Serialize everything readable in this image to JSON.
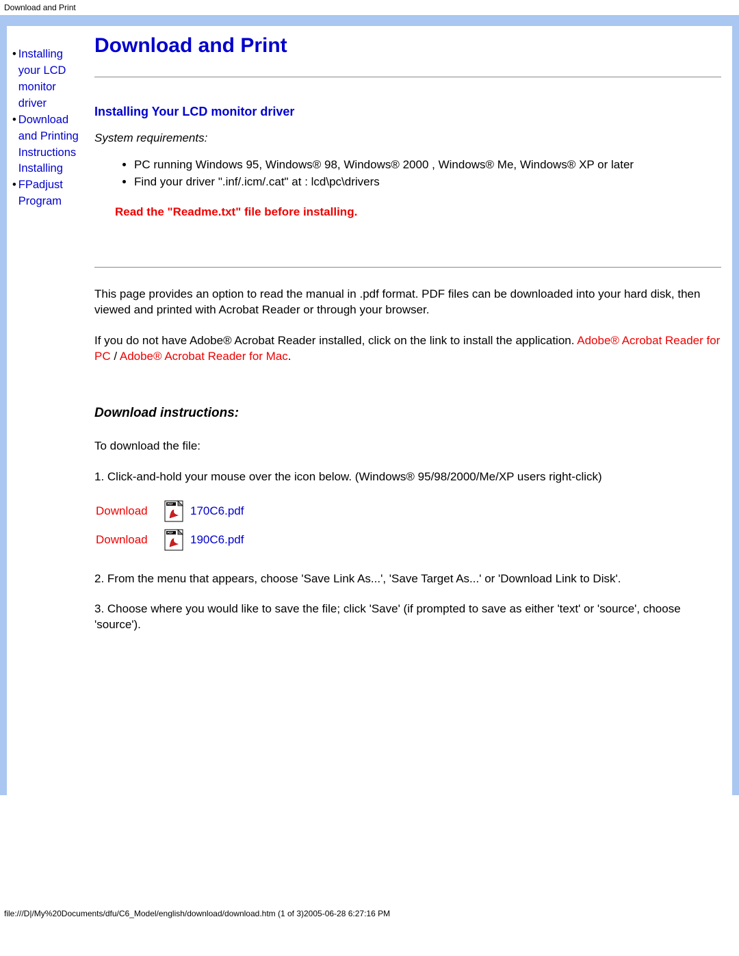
{
  "header": "Download and Print",
  "sidebar": {
    "items": [
      {
        "label": "Installing your LCD monitor driver"
      },
      {
        "label": "Download and Printing Instructions Installing"
      },
      {
        "label": "FPadjust Program"
      }
    ]
  },
  "main": {
    "title": "Download and Print",
    "section_heading": "Installing Your LCD monitor driver",
    "sysreq_label": "System requirements:",
    "reqs": [
      "PC running Windows 95, Windows® 98, Windows® 2000 , Windows® Me, Windows® XP or later",
      "Find your driver \".inf/.icm/.cat\" at : lcd\\pc\\drivers"
    ],
    "readme": "Read the \"Readme.txt\" file before installing.",
    "para1": "This page provides an option to read the manual in .pdf format. PDF files can be downloaded into your hard disk, then viewed and printed with Acrobat Reader or through your browser.",
    "para2_pre": "If you do not have Adobe® Acrobat Reader installed, click on the link to install the application. ",
    "acrobat_pc": "Adobe® Acrobat Reader for PC",
    "slash": " / ",
    "acrobat_mac": "Adobe® Acrobat Reader for Mac",
    "period": ".",
    "download_heading": "Download instructions:",
    "download_intro": "To download the file:",
    "step1": "1. Click-and-hold your mouse over the icon below. (Windows® 95/98/2000/Me/XP users right-click)",
    "downloads": [
      {
        "label": "Download",
        "file": "170C6.pdf"
      },
      {
        "label": "Download",
        "file": "190C6.pdf"
      }
    ],
    "step2": "2. From the menu that appears, choose 'Save Link As...', 'Save Target As...' or 'Download Link to Disk'.",
    "step3": "3. Choose where you would like to save the file; click 'Save' (if prompted to save as either 'text' or 'source', choose 'source')."
  },
  "footer": "file:///D|/My%20Documents/dfu/C6_Model/english/download/download.htm (1 of 3)2005-06-28 6:27:16 PM"
}
